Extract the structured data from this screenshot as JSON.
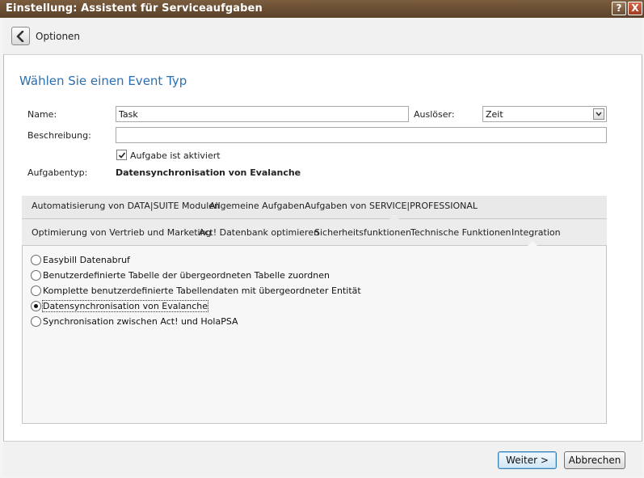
{
  "window": {
    "title": "Einstellung: Assistent für Serviceaufgaben",
    "help_label": "?",
    "close_label": "X"
  },
  "header": {
    "label": "Optionen"
  },
  "main": {
    "heading": "Wählen Sie einen Event Typ",
    "name_label": "Name:",
    "name_value": "Task",
    "trigger_label": "Auslöser:",
    "trigger_value": "Zeit",
    "description_label": "Beschreibung:",
    "description_value": "",
    "active_label": "Aufgabe ist aktiviert",
    "active_checked": true,
    "task_type_label": "Aufgabentyp:",
    "task_type_value": "Datensynchronisation von Evalanche"
  },
  "tabs": {
    "row1": [
      "Automatisierung von DATA|SUITE Modulen",
      "Allgemeine Aufgaben",
      "Aufgaben von SERVICE|PROFESSIONAL"
    ],
    "row2": [
      "Optimierung von Vertrieb und Marketing",
      "Act! Datenbank optimieren",
      "Sicherheitsfunktionen",
      "Technische Funktionen",
      "Integration"
    ],
    "selected": "Integration"
  },
  "options": [
    {
      "label": "Easybill Datenabruf",
      "selected": false
    },
    {
      "label": "Benutzerdefinierte Tabelle der übergeordneten Tabelle zuordnen",
      "selected": false
    },
    {
      "label": "Komplette benutzerdefinierte Tabellendaten mit übergeordneter Entität",
      "selected": false
    },
    {
      "label": "Datensynchronisation von Evalanche",
      "selected": true
    },
    {
      "label": "Synchronisation zwischen Act! und HolaPSA",
      "selected": false
    }
  ],
  "footer": {
    "next_label": "Weiter >",
    "cancel_label": "Abbrechen"
  }
}
